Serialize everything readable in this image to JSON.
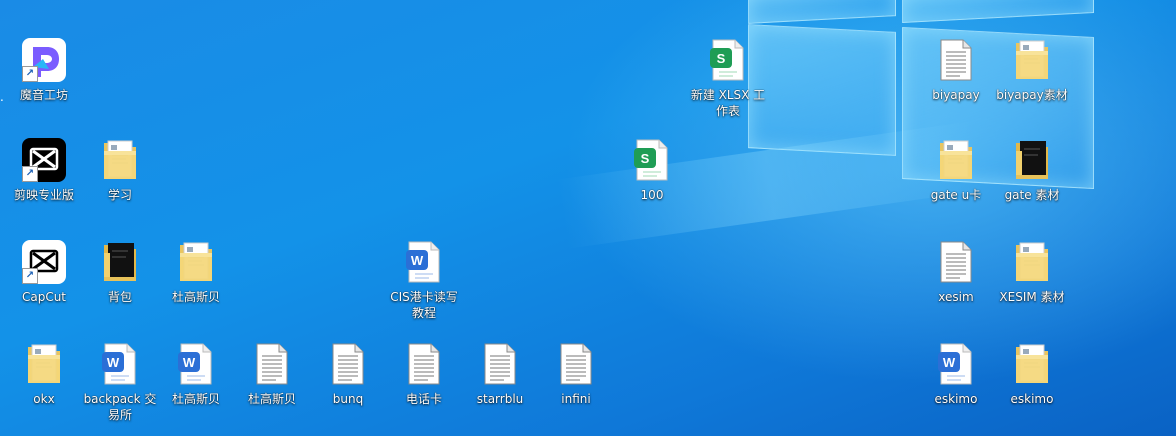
{
  "desktop": {
    "icons": [
      {
        "label": "魔音工坊",
        "type": "app-moyin",
        "shortcut": true
      },
      {
        "label": "剪映专业版",
        "type": "app-capcut-pro",
        "shortcut": true
      },
      {
        "label": "学习",
        "type": "folder-docs"
      },
      {
        "label": "CapCut",
        "type": "app-capcut",
        "shortcut": true
      },
      {
        "label": "背包",
        "type": "folder-dark"
      },
      {
        "label": "杜高斯贝",
        "type": "folder-docs"
      },
      {
        "label": "CIS港卡读写教程",
        "type": "word-doc"
      },
      {
        "label": "新建 XLSX 工作表",
        "type": "xlsx-doc"
      },
      {
        "label": "100",
        "type": "xlsx-doc"
      },
      {
        "label": "okx",
        "type": "folder-docs"
      },
      {
        "label": "backpack 交易所",
        "type": "word-doc"
      },
      {
        "label": "杜高斯贝",
        "type": "word-doc"
      },
      {
        "label": "杜高斯贝",
        "type": "text-doc"
      },
      {
        "label": "bunq",
        "type": "text-doc"
      },
      {
        "label": "电话卡",
        "type": "text-doc"
      },
      {
        "label": "starrblu",
        "type": "text-doc"
      },
      {
        "label": "infini",
        "type": "text-doc"
      },
      {
        "label": "biyapay",
        "type": "text-doc"
      },
      {
        "label": "biyapay素材",
        "type": "folder-docs"
      },
      {
        "label": "gate u卡",
        "type": "folder-docs"
      },
      {
        "label": "gate 素材",
        "type": "folder-dark"
      },
      {
        "label": "xesim",
        "type": "text-doc"
      },
      {
        "label": "XESIM 素材",
        "type": "folder-docs"
      },
      {
        "label": "eskimo",
        "type": "word-doc"
      },
      {
        "label": "eskimo",
        "type": "folder-docs"
      }
    ],
    "colors": {
      "wallpaper": "#1392e8",
      "xlsx": "#1f9d55",
      "word": "#2b6fd6"
    }
  }
}
